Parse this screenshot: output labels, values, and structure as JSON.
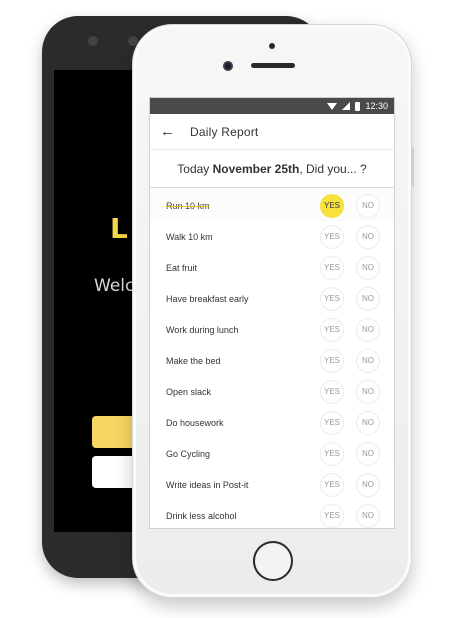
{
  "back_phone": {
    "logo": "L",
    "welcome": "Welco"
  },
  "status_bar": {
    "time": "12:30"
  },
  "app_bar": {
    "back_icon": "arrow-left-icon",
    "title": "Daily Report"
  },
  "question": {
    "prefix": "Today ",
    "date": "November 25th",
    "suffix": ", Did you... ?"
  },
  "tasks": [
    {
      "name": "Run 10 km",
      "done": true,
      "answer": "YES"
    },
    {
      "name": "Walk 10 km",
      "done": false,
      "answer": ""
    },
    {
      "name": "Eat fruit",
      "done": false,
      "answer": ""
    },
    {
      "name": "Have breakfast early",
      "done": false,
      "answer": ""
    },
    {
      "name": "Work during lunch",
      "done": false,
      "answer": ""
    },
    {
      "name": "Make the bed",
      "done": false,
      "answer": ""
    },
    {
      "name": "Open slack",
      "done": false,
      "answer": ""
    },
    {
      "name": "Do housework",
      "done": false,
      "answer": ""
    },
    {
      "name": "Go Cycling",
      "done": false,
      "answer": ""
    },
    {
      "name": "Write ideas in Post-it",
      "done": false,
      "answer": ""
    },
    {
      "name": "Drink less alcohol",
      "done": false,
      "answer": ""
    }
  ],
  "labels": {
    "yes": "YES",
    "no": "NO"
  },
  "colors": {
    "accent": "#f7e13b",
    "back_button": "#f7d663",
    "status_bar": "#4a4a4a"
  }
}
